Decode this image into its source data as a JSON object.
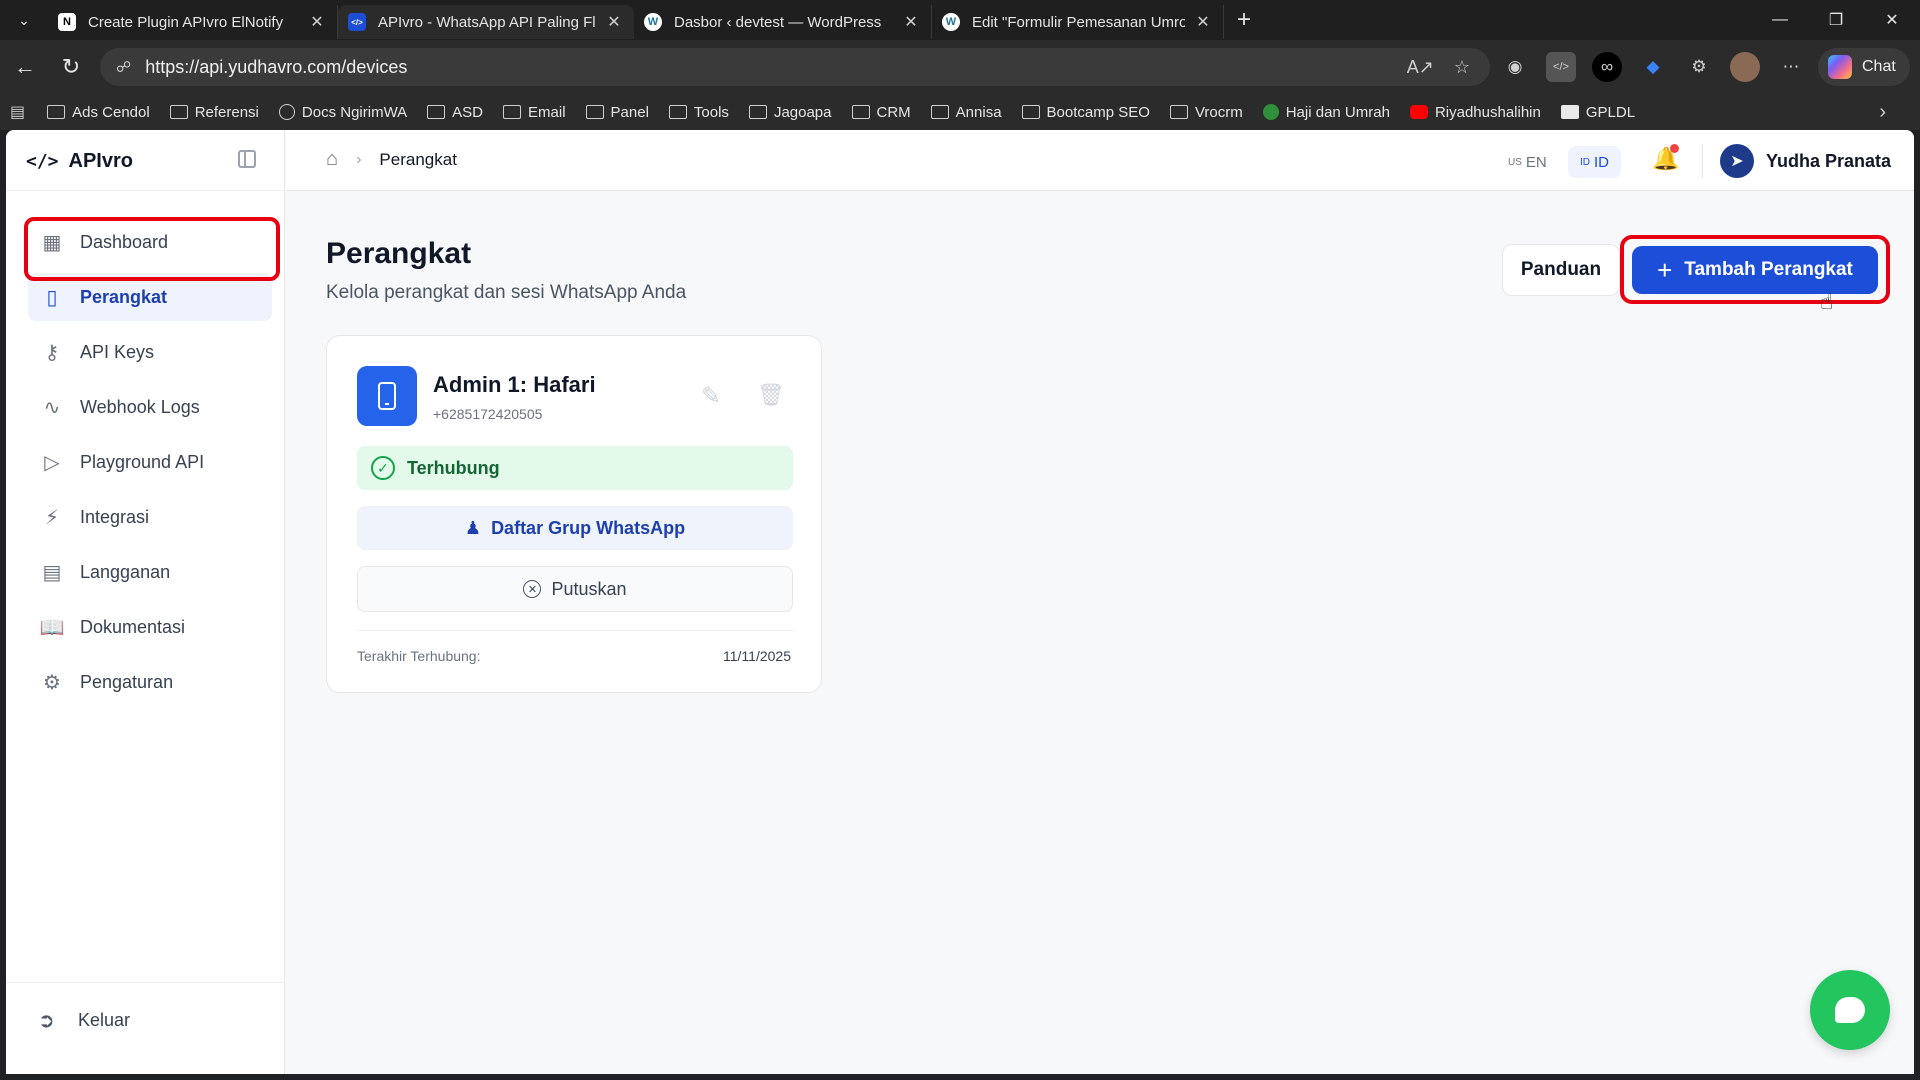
{
  "browser": {
    "tabs": [
      {
        "title": "Create Plugin APIvro ElNotify",
        "favicon": "N",
        "favicon_bg": "#ffffff",
        "favicon_color": "#000000"
      },
      {
        "title": "APIvro - WhatsApp API Paling Fle",
        "favicon": "</>",
        "favicon_bg": "#1d4ed8",
        "favicon_color": "#ffffff"
      },
      {
        "title": "Dasbor ‹ devtest — WordPress",
        "favicon": "W",
        "favicon_bg": "#ffffff",
        "favicon_color": "#21759b"
      },
      {
        "title": "Edit \"Formulir Pemesanan Umroh",
        "favicon": "W",
        "favicon_bg": "#ffffff",
        "favicon_color": "#21759b"
      }
    ],
    "url": "https://api.yudhavro.com/devices",
    "chat_label": "Chat",
    "bookmarks": [
      "Ads Cendol",
      "Referensi",
      "Docs NgirimWA",
      "ASD",
      "Email",
      "Panel",
      "Tools",
      "Jagoapa",
      "CRM",
      "Annisa",
      "Bootcamp SEO",
      "Vrocrm",
      "Haji dan Umrah",
      "Riyadhushalihin",
      "GPLDL"
    ]
  },
  "app": {
    "brand": "APIvro",
    "nav": [
      {
        "label": "Dashboard",
        "icon": "grid-icon"
      },
      {
        "label": "Perangkat",
        "icon": "phone-icon"
      },
      {
        "label": "API Keys",
        "icon": "key-icon"
      },
      {
        "label": "Webhook Logs",
        "icon": "activity-icon"
      },
      {
        "label": "Playground API",
        "icon": "play-icon"
      },
      {
        "label": "Integrasi",
        "icon": "zap-icon"
      },
      {
        "label": "Langganan",
        "icon": "card-icon"
      },
      {
        "label": "Dokumentasi",
        "icon": "book-icon"
      },
      {
        "label": "Pengaturan",
        "icon": "gear-icon"
      }
    ],
    "active_nav": "Perangkat",
    "logout_label": "Keluar",
    "breadcrumb": "Perangkat",
    "lang_en": {
      "flag": "US",
      "code": "EN"
    },
    "lang_id": {
      "flag": "ID",
      "code": "ID"
    },
    "user_name": "Yudha Pranata",
    "page_title": "Perangkat",
    "page_subtitle": "Kelola perangkat dan sesi WhatsApp Anda",
    "guide_button": "Panduan",
    "add_button": "Tambah Perangkat",
    "device": {
      "name": "Admin 1: Hafari",
      "phone": "+6285172420505",
      "status": "Terhubung",
      "group_button": "Daftar Grup WhatsApp",
      "disconnect_button": "Putuskan",
      "last_connected_label": "Terakhir Terhubung:",
      "last_connected_value": "11/11/2025"
    }
  },
  "colors": {
    "primary": "#1d4ed8",
    "success": "#16a34a",
    "highlight": "#e60012",
    "fab": "#22c55e"
  }
}
